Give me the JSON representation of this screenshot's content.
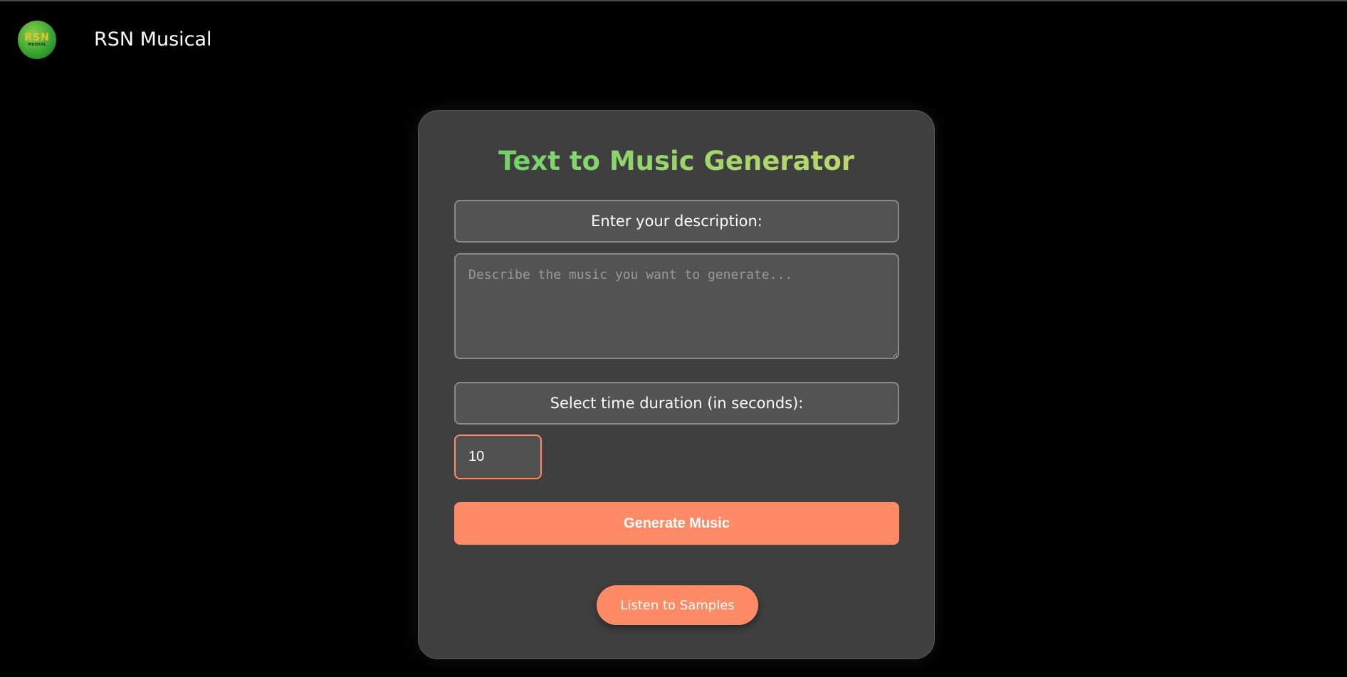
{
  "navbar": {
    "logo": {
      "main_text": "RSN",
      "sub_text": "MUSICAL",
      "icon": "rsn-logo"
    },
    "brand": "RSN Musical"
  },
  "generator": {
    "title": "Text to Music Generator",
    "description_label": "Enter your description:",
    "description_value": "",
    "description_placeholder": "Describe the music you want to generate...",
    "duration_label": "Select time duration (in seconds):",
    "duration_value": "10",
    "generate_label": "Generate Music",
    "samples_label": "Listen to Samples"
  },
  "colors": {
    "background": "#000000",
    "card": "#3f3f3f",
    "accent": "#ff8a66",
    "title_gradient_start": "#5fd16a",
    "title_gradient_end": "#c9d86f"
  }
}
